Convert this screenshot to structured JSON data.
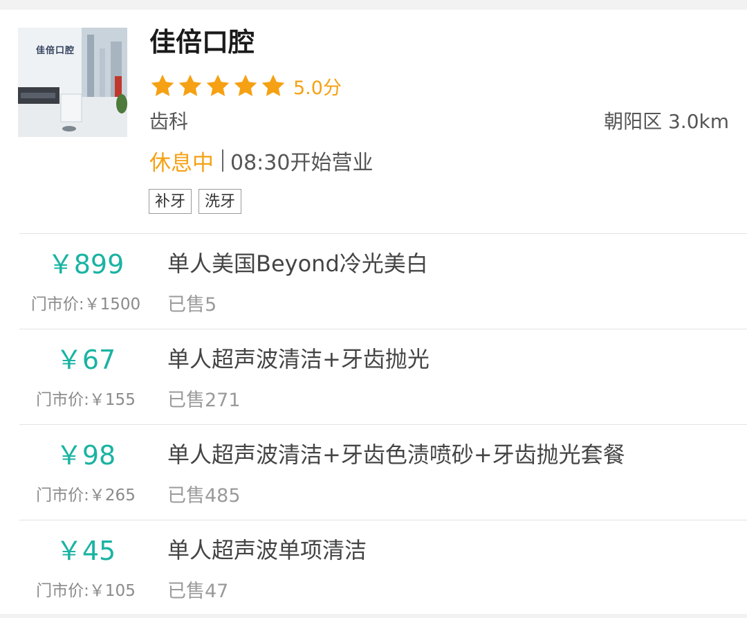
{
  "merchant": {
    "name": "佳倍口腔",
    "thumbnail_logo_text": "佳倍口腔",
    "rating": {
      "stars_filled": 5,
      "stars_total": 5,
      "score_text": "5.0分"
    },
    "category": "齿科",
    "location": "朝阳区 3.0km",
    "status": "休息中",
    "hours_text": "08:30开始营业",
    "tags": [
      "补牙",
      "洗牙"
    ]
  },
  "colors": {
    "accent_orange": "#f5a113",
    "price_teal": "#1ab3a3"
  },
  "deals": [
    {
      "price": "￥899",
      "original_price": "门市价:￥1500",
      "title": "单人美国Beyond冷光美白",
      "sold": "已售5"
    },
    {
      "price": "￥67",
      "original_price": "门市价:￥155",
      "title": "单人超声波清洁+牙齿抛光",
      "sold": "已售271"
    },
    {
      "price": "￥98",
      "original_price": "门市价:￥265",
      "title": "单人超声波清洁+牙齿色渍喷砂+牙齿抛光套餐",
      "sold": "已售485"
    },
    {
      "price": "￥45",
      "original_price": "门市价:￥105",
      "title": "单人超声波单项清洁",
      "sold": "已售47"
    }
  ]
}
